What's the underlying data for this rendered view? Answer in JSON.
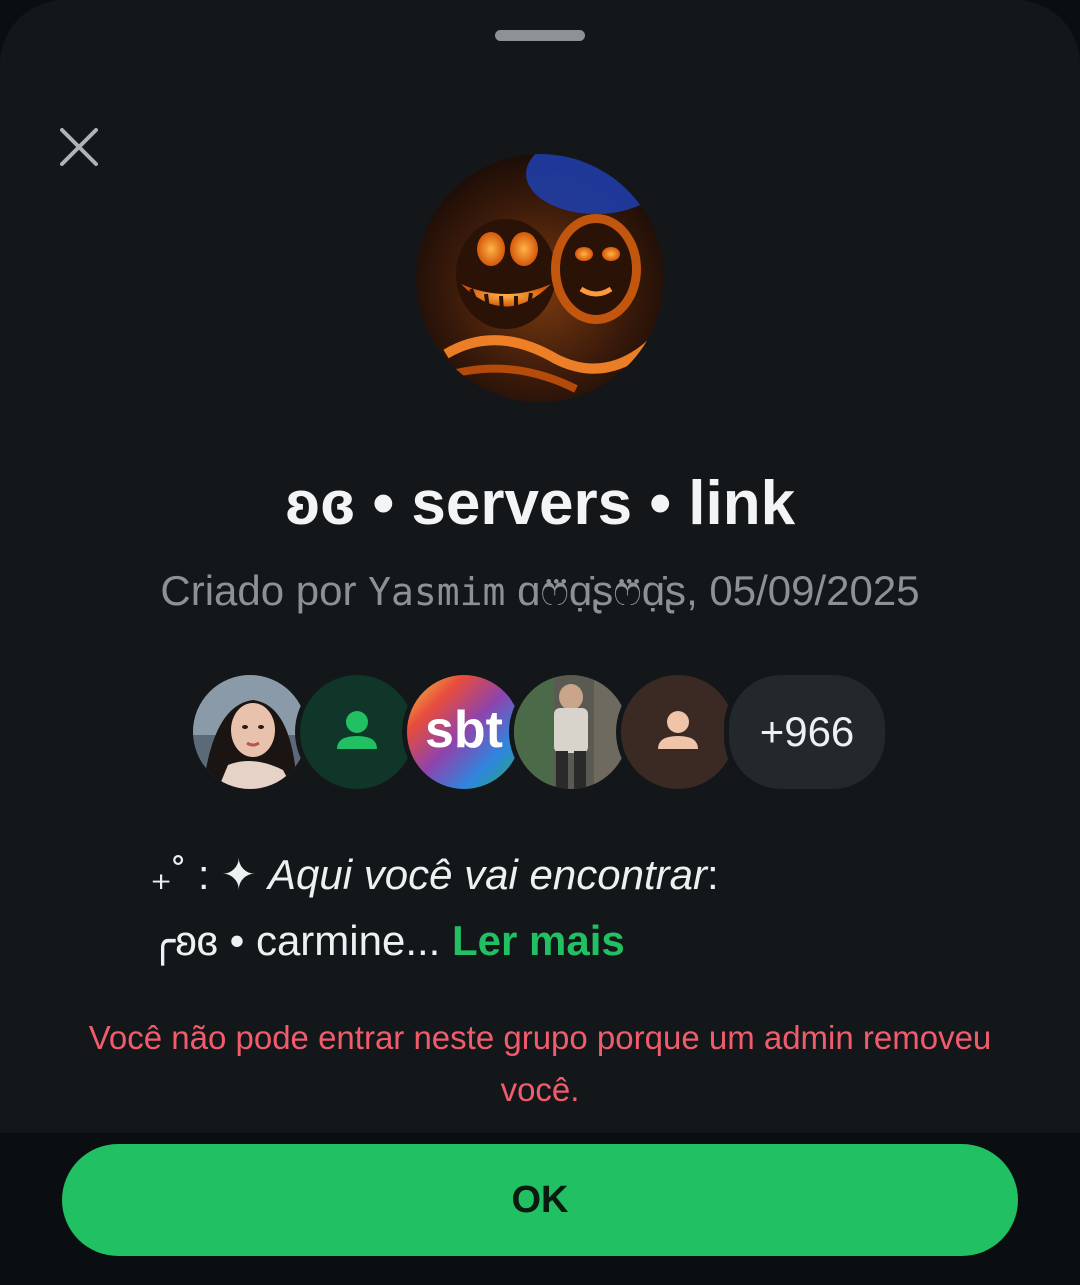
{
  "sheet": {
    "close_icon": "close-icon"
  },
  "group": {
    "title": "ʚɞ • servers • link",
    "created_prefix": "Criado por ",
    "creator_name": "Yasmim",
    "creator_decoration": " ɑෆ⃛ɑ̣̇ʂෆ⃛ɑ̣̇ʂ",
    "created_date": ", 05/09/2025"
  },
  "members": {
    "avatars": [
      {
        "type": "photo-portrait"
      },
      {
        "type": "default-avatar",
        "bg": "#103529",
        "fg": "#21c063"
      },
      {
        "type": "logo-sbt",
        "text": "sbt"
      },
      {
        "type": "photo-person"
      },
      {
        "type": "default-avatar",
        "bg": "#3b2a24",
        "fg": "#f0c4a8"
      }
    ],
    "more_count": "+966"
  },
  "description": {
    "line1_prefix": "₊˚ : ✦ ",
    "line1_text": "Aqui você vai encontrar",
    "line1_suffix": ":",
    "line2_prefix": "╭ʚɞ • ",
    "line2_text": "carmine...",
    "read_more": "Ler mais"
  },
  "error": {
    "message": "Você não pode entrar neste grupo porque um admin removeu você."
  },
  "actions": {
    "ok_label": "OK"
  },
  "colors": {
    "accent": "#21c063",
    "error": "#f15c6d",
    "background": "#13171a"
  }
}
